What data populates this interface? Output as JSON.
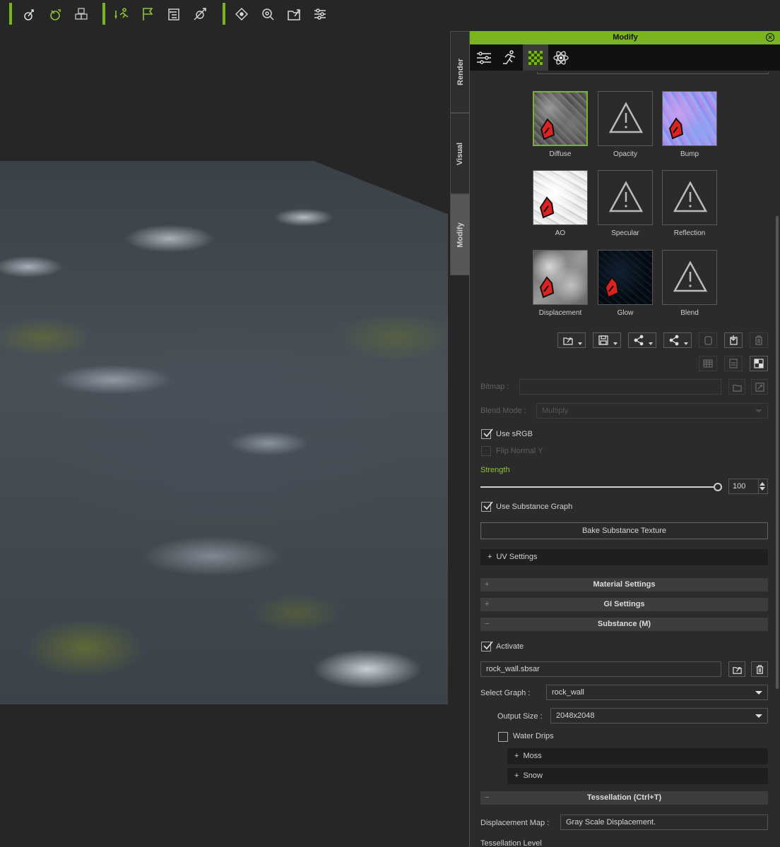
{
  "toolbar": {
    "icons": [
      "reach-target-icon",
      "look-at-icon",
      "scene-objects-icon",
      "motion-icon",
      "flag-icon",
      "settings-list-icon",
      "path-icon",
      "diamond-icon",
      "zoom-target-icon",
      "export-folder-icon",
      "adjust-icon"
    ]
  },
  "side_tabs": {
    "render": "Render",
    "visual": "Visual",
    "modify": "Modify"
  },
  "panel": {
    "title": "Modify",
    "tabs": [
      "sliders-icon",
      "motion-pose-icon",
      "material-icon",
      "atom-icon"
    ]
  },
  "textures": {
    "diffuse": "Diffuse",
    "opacity": "Opacity",
    "bump": "Bump",
    "ao": "AO",
    "specular": "Specular",
    "reflection": "Reflection",
    "displacement": "Displacement",
    "glow": "Glow",
    "blend": "Blend"
  },
  "fields": {
    "bitmap_label": "Bitmap :",
    "bitmap_value": "",
    "blend_mode_label": "Blend Mode :",
    "blend_mode_value": "Multiply",
    "use_srgb": "Use sRGB",
    "flip_normal": "Flip Normal Y",
    "strength_label": "Strength",
    "strength_value": "100",
    "use_substance_graph": "Use Substance Graph",
    "bake_button": "Bake Substance Texture",
    "uv_settings": "UV Settings"
  },
  "sections": {
    "material_settings": "Material Settings",
    "gi_settings": "GI Settings",
    "substance": "Substance (M)",
    "tessellation": "Tessellation  (Ctrl+T)"
  },
  "substance": {
    "activate": "Activate",
    "file": "rock_wall.sbsar",
    "select_graph_label": "Select Graph :",
    "select_graph_value": "rock_wall",
    "output_size_label": "Output Size :",
    "output_size_value": "2048x2048",
    "water_drips": "Water Drips",
    "moss": "Moss",
    "snow": "Snow"
  },
  "tessellation": {
    "displacement_map_label": "Displacement Map :",
    "displacement_map_value": "Gray Scale Displacement.",
    "level_label": "Tessellation Level"
  },
  "colors": {
    "accent": "#7ab51d",
    "background": "#262626",
    "panel": "#2b2b2b"
  }
}
